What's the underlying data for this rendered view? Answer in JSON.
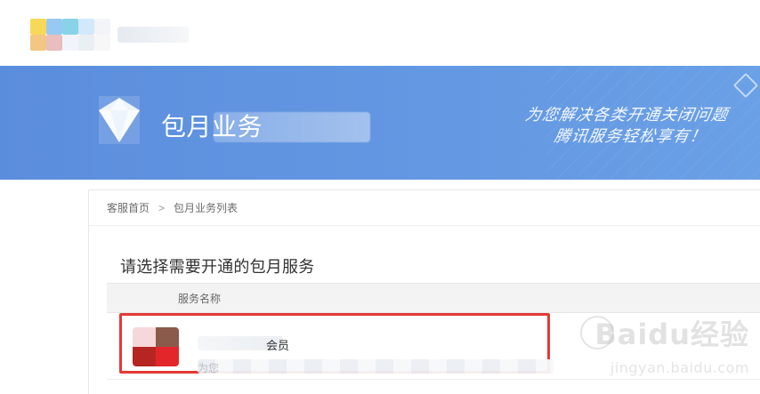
{
  "colors": {
    "banner_bg": "#5b8ddd",
    "banner_bg_2": "#6aa0e6",
    "highlight": "#e53935",
    "table_header_bg": "#f3f3f3",
    "text_primary": "#333333",
    "text_secondary": "#666666"
  },
  "banner": {
    "title_prefix": "包月业务",
    "slogan_line1": "为您解决各类开通关闭问题",
    "slogan_line2": "腾讯服务轻松享有！"
  },
  "breadcrumb": {
    "home": "客服首页",
    "separator": ">",
    "current": "包月业务列表"
  },
  "main": {
    "heading": "请选择需要开通的包月服务"
  },
  "table": {
    "header": {
      "service_name": "服务名称"
    },
    "rows": [
      {
        "title_suffix": "会员",
        "desc_prefix": "为您"
      }
    ]
  },
  "watermark": {
    "brand": "Baidu经验",
    "site": "jingyan.baidu.com"
  },
  "icons": {
    "top_logo": "blurred-logo-icon",
    "banner_icon": "diamond-logo-icon",
    "service_icon": "service-thumbnail-icon",
    "watermark_icon": "paw-icon"
  }
}
